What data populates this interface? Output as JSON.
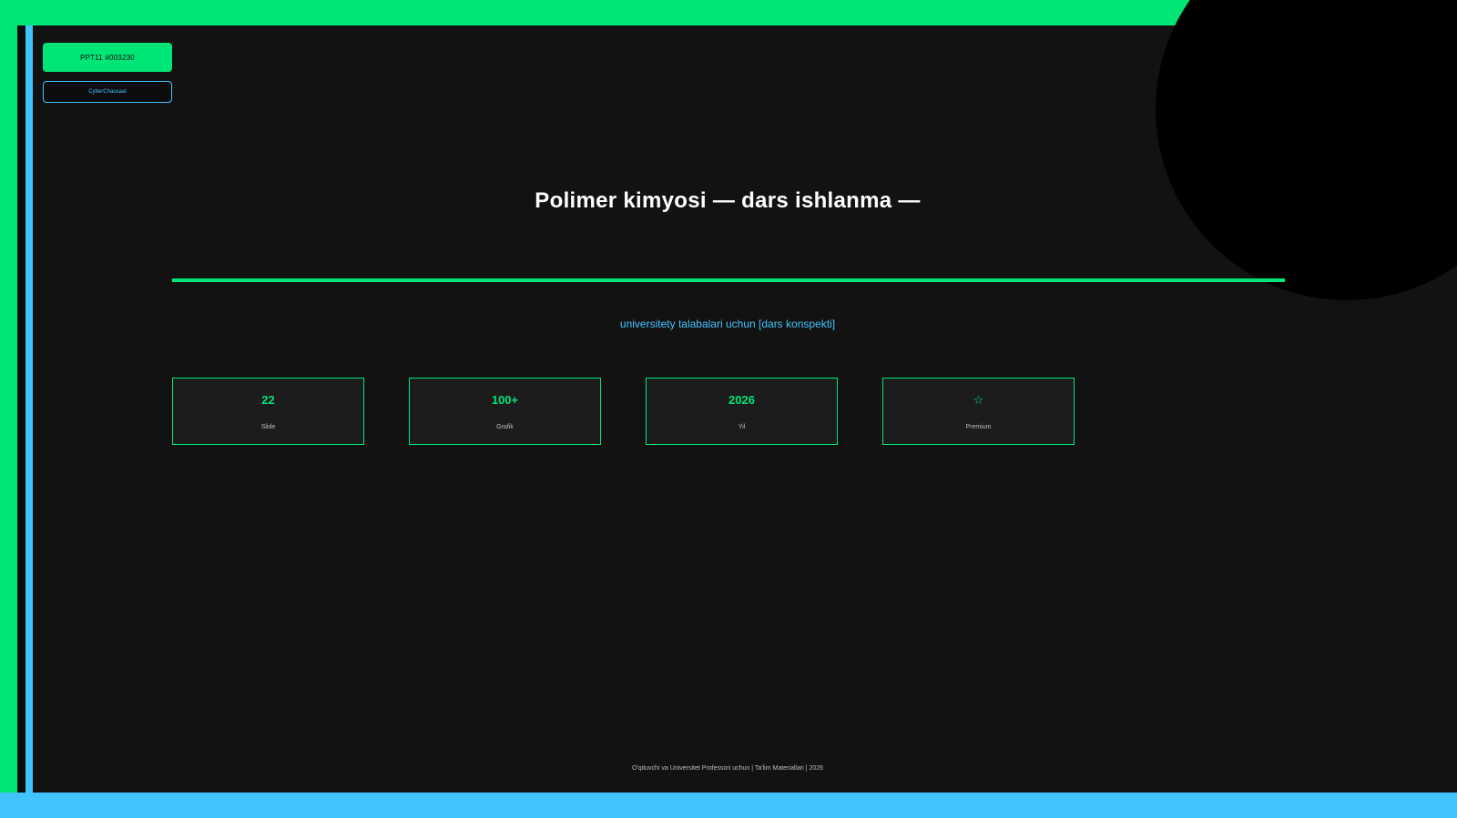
{
  "colors": {
    "accent_green": "#00e676",
    "accent_blue": "#40c4ff"
  },
  "header": {
    "badge_id": "PPT11 #003230",
    "badge_brand": "CyberChausaal"
  },
  "main": {
    "title": "Polimer kimyosi — dars ishlanma —",
    "subtitle": "universitety talabalari uchun [dars konspekti]"
  },
  "stats": [
    {
      "value": "22",
      "label": "Slide"
    },
    {
      "value": "100+",
      "label": "Grafik"
    },
    {
      "value": "2026",
      "label": "Yil"
    },
    {
      "value": "☆",
      "label": "Premium"
    }
  ],
  "footer": {
    "text": "O'qituvchi va Universitet Professori uchun | Ta'lim Materiallari | 2026"
  }
}
